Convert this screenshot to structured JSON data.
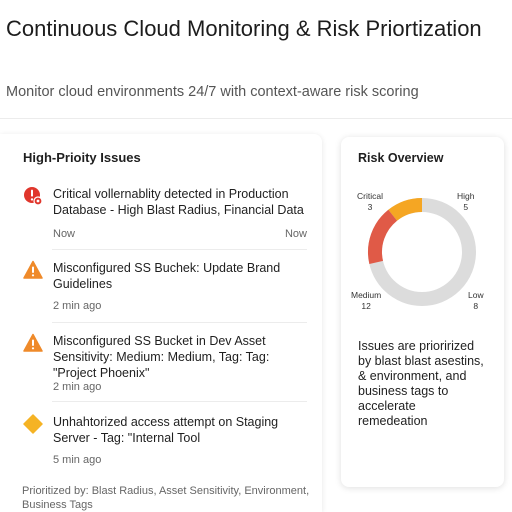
{
  "header": {
    "title": "Continuous Cloud Monitoring & Risk Priortization",
    "subtitle": "Monitor cloud environments 24/7 with context-aware risk scoring"
  },
  "issues_panel": {
    "title": "High-Prioity Issues",
    "issues": [
      {
        "icon": "critical-alert-icon",
        "color": "#e0362c",
        "text": "Critical vollernablity detected in Production Database - High Blast Radius, Financial Data",
        "time": "Now",
        "time_right": "Now"
      },
      {
        "icon": "warning-icon",
        "color": "#ef8a2a",
        "text": "Misconfigured SS Buchek: Update Brand Guidelines",
        "time": "2 min ago"
      },
      {
        "icon": "warning-icon",
        "color": "#ef8a2a",
        "text": "Misconfigured SS Bucket in Dev Asset Sensitivity: Medium: Medium, Tag: Tag: \"Project Phoenix\"",
        "time": "2 min ago"
      },
      {
        "icon": "diamond-alert-icon",
        "color": "#f5b324",
        "text": "Unhahtorized access attempt on Staging Server - Tag: \"Internal Tool",
        "time": "5 min ago"
      }
    ],
    "footer": "Prioritized by: Blast Radius, Asset Sensitivity, Environment, Business Tags"
  },
  "overview_panel": {
    "title": "Risk Overview",
    "segments": [
      {
        "name": "Critical",
        "value": 3,
        "color": "#f5a623"
      },
      {
        "name": "High",
        "value": 5,
        "color": "#e05a47"
      },
      {
        "name": "Medium",
        "value": 12,
        "color": "#dcdcdc"
      },
      {
        "name": "Low",
        "value": 8,
        "color": "#dcdcdc"
      }
    ],
    "description": "Issues are priorirized by blast blast asestins, & environment, and business tags to accelerate remedeation"
  }
}
